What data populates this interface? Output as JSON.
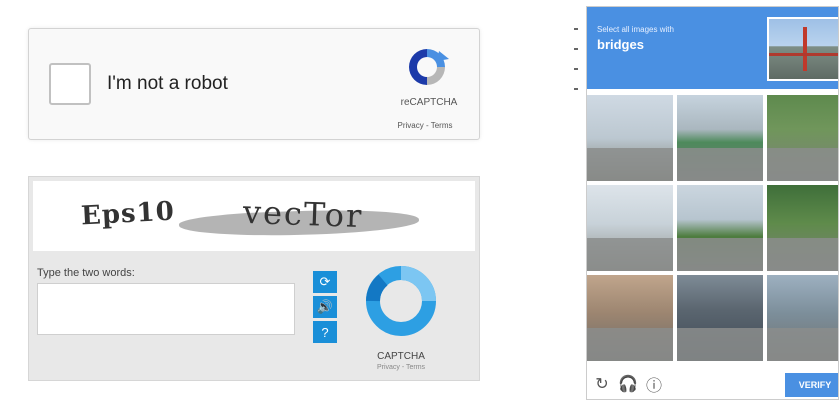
{
  "recaptcha_checkbox": {
    "label": "I'm not a robot",
    "brand": "reCAPTCHA",
    "links": "Privacy - Terms",
    "logo_icon": "recaptcha-logo-icon",
    "colors": {
      "logo_blue": "#1c3aa9",
      "logo_light": "#4a90e2",
      "logo_gray": "#b7b7b7"
    }
  },
  "text_captcha": {
    "distorted_words": [
      "Eps10",
      "vecTor"
    ],
    "prompt": "Type the two words:",
    "input_value": "",
    "buttons": [
      {
        "name": "refresh",
        "icon": "refresh-icon",
        "glyph": "⟳"
      },
      {
        "name": "audio",
        "icon": "audio-icon",
        "glyph": "🔊"
      },
      {
        "name": "help",
        "icon": "help-icon",
        "glyph": "?"
      }
    ],
    "brand": "CAPTCHA",
    "sub_links": "Privacy - Terms",
    "colors": {
      "button_blue": "#1a8fd8",
      "ring_blue": "#2d9fe3"
    }
  },
  "image_challenge": {
    "instruction": "Select all images with",
    "target": "bridges",
    "tiles": [
      {
        "name": "tile-1",
        "selected": false
      },
      {
        "name": "tile-2",
        "selected": false
      },
      {
        "name": "tile-3",
        "selected": false
      },
      {
        "name": "tile-4",
        "selected": false
      },
      {
        "name": "tile-5",
        "selected": false
      },
      {
        "name": "tile-6",
        "selected": false
      },
      {
        "name": "tile-7",
        "selected": false
      },
      {
        "name": "tile-8",
        "selected": false
      },
      {
        "name": "tile-9",
        "selected": false
      }
    ],
    "footer": {
      "reload_glyph": "↻",
      "audio_glyph": "🎧",
      "info_glyph": "ⓘ",
      "verify_label": "VERIFY"
    },
    "colors": {
      "header_blue": "#4a90e2"
    }
  }
}
